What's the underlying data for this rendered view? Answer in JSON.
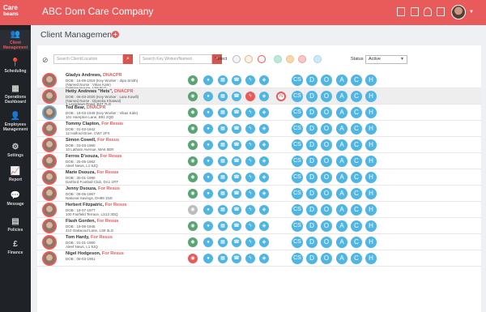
{
  "brand": {
    "line1": "Care",
    "line2": "beans"
  },
  "header": {
    "company": "ABC Dom Care Company"
  },
  "sidebar": [
    {
      "label": "Client Management",
      "icon": "users-icon",
      "glyph": "👥"
    },
    {
      "label": "Scheduling",
      "icon": "map-pin-icon",
      "glyph": "📍"
    },
    {
      "label": "Operations Dashboard",
      "icon": "dashboard-icon",
      "glyph": "▦"
    },
    {
      "label": "Employees Management",
      "icon": "employees-icon",
      "glyph": "👤"
    },
    {
      "label": "Settings",
      "icon": "gear-icon",
      "glyph": "⚙"
    },
    {
      "label": "Report",
      "icon": "chart-icon",
      "glyph": "📈"
    },
    {
      "label": "Message",
      "icon": "message-icon",
      "glyph": "💬"
    },
    {
      "label": "Policies",
      "icon": "document-icon",
      "glyph": "▤"
    },
    {
      "label": "Finance",
      "icon": "pound-icon",
      "glyph": "£"
    }
  ],
  "page": {
    "title": "Client Management"
  },
  "toolbar": {
    "search_client_placeholder": "Search Client/Location",
    "search_worker_placeholder": "Search Key Worker/Named",
    "select_label": "Select",
    "status_label": "Status",
    "status_value": "Active"
  },
  "letters": [
    "CS",
    "D",
    "O",
    "A",
    "C",
    "H"
  ],
  "clients": [
    {
      "name": "Gladys Andrews,",
      "tag": "DNACPR",
      "line1": "DOB : 16-09-1919 (Key Worker : dipa Smith)",
      "line2": "(Named Nurse : Vikas Kale)",
      "line3": "Oaktree House, LS8 8LG"
    },
    {
      "name": "Hetty Andrews \"Hets\",",
      "tag": "DNACPR",
      "line1": "DOB : 06-03-2020 (Key Worker : Lara Kowifi)",
      "line2": "(Named Nurse : Dipeeka Khatwal)",
      "line3": "1 Leysdown Road, B27 7LG"
    },
    {
      "name": "Ted Bear,",
      "tag": "DNACPR",
      "line1": "DOB : 18-03-1949 (Key Worker : Vikas Kale)",
      "line2": "101 Hampton Lane, B91 2QD",
      "line3": ""
    },
    {
      "name": "Tommy Clapton,",
      "tag": "For Resus",
      "line1": "DOB : 01-03-1942",
      "line2": "12 Halford Drive, CW7 2FX",
      "line3": ""
    },
    {
      "name": "Simon Cowell,",
      "tag": "For Resus",
      "line1": "DOB : 03-03-1960",
      "line2": "10 Latham Avenue, WA6 0ER",
      "line3": ""
    },
    {
      "name": "Ferros D'souza,",
      "tag": "For Resus",
      "line1": "DOB : 25-05-1962",
      "line2": "Aleef News, L1 8JQ",
      "line3": ""
    },
    {
      "name": "Marie Dsouza,",
      "tag": "For Resus",
      "line1": "DOB : 30-01-1990",
      "line2": "Dartford Football Club, DA1 1RT",
      "line3": ""
    },
    {
      "name": "Jenny Dsouza,",
      "tag": "For Resus",
      "line1": "DOB : 09-05-1967",
      "line2": "National Savings, DH99 1NS",
      "line3": ""
    },
    {
      "name": "Herbert Fitzpatric,",
      "tag": "For Resus",
      "line1": "DOB : 18-07-1977",
      "line2": "100 Fairfield Terrace, LS13 3DQ",
      "line3": ""
    },
    {
      "name": "Flash Gorden,",
      "tag": "For Resus",
      "line1": "DOB : 19-06-1945",
      "line2": "410 Oakwood Lane, LS8 3LG",
      "line3": ""
    },
    {
      "name": "Tom Hardy,",
      "tag": "For Resus",
      "line1": "DOB : 01-01-1950",
      "line2": "Aleef News, L1 8JQ",
      "line3": ""
    },
    {
      "name": "Nigel Hodgeson,",
      "tag": "For Resus",
      "line1": "DOB : 08-03-1951",
      "line2": "",
      "line3": ""
    }
  ]
}
